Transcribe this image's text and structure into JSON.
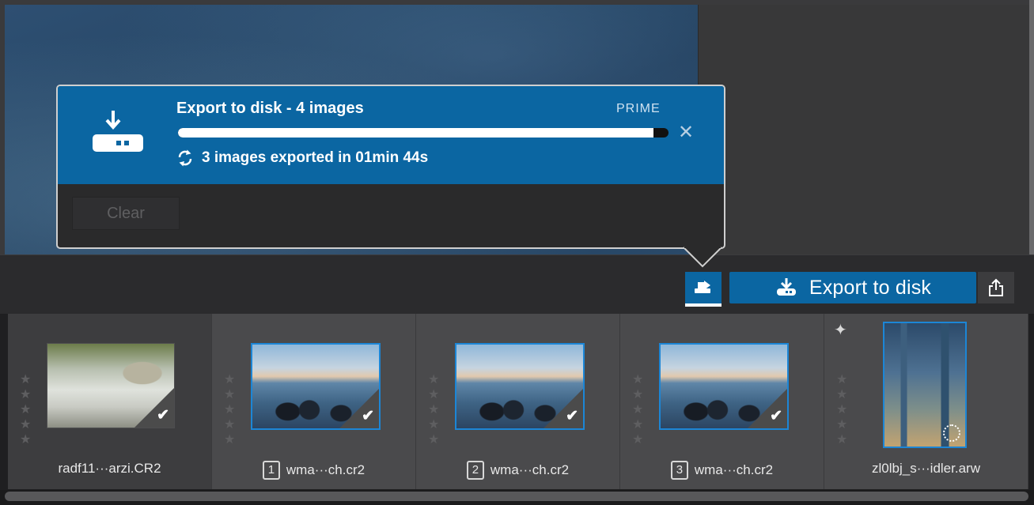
{
  "popup": {
    "title": "Export to disk - 4 images",
    "badge": "PRIME",
    "progress": 0.97,
    "status": "3 images exported in 01min 44s",
    "close_symbol": "✕",
    "clear_label": "Clear"
  },
  "toolbar": {
    "export_label": "Export to disk",
    "export_icon": "download-to-disk-icon",
    "queue_icon": "export-queue-icon",
    "share_icon": "share-icon"
  },
  "filmstrip": {
    "items": [
      {
        "filename": "radf11···arzi.CR2",
        "badge": "",
        "exported": true
      },
      {
        "filename": "wma···ch.cr2",
        "badge": "1",
        "exported": true
      },
      {
        "filename": "wma···ch.cr2",
        "badge": "2",
        "exported": true
      },
      {
        "filename": "wma···ch.cr2",
        "badge": "3",
        "exported": true
      },
      {
        "filename": "zl0lbj_s···idler.arw",
        "badge": "",
        "exported": false
      }
    ],
    "check_symbol": "✔",
    "star_symbol": "★",
    "sparkle_symbol": "✦"
  },
  "colors": {
    "accent": "#0b66a2",
    "selection": "#1c86d6"
  }
}
